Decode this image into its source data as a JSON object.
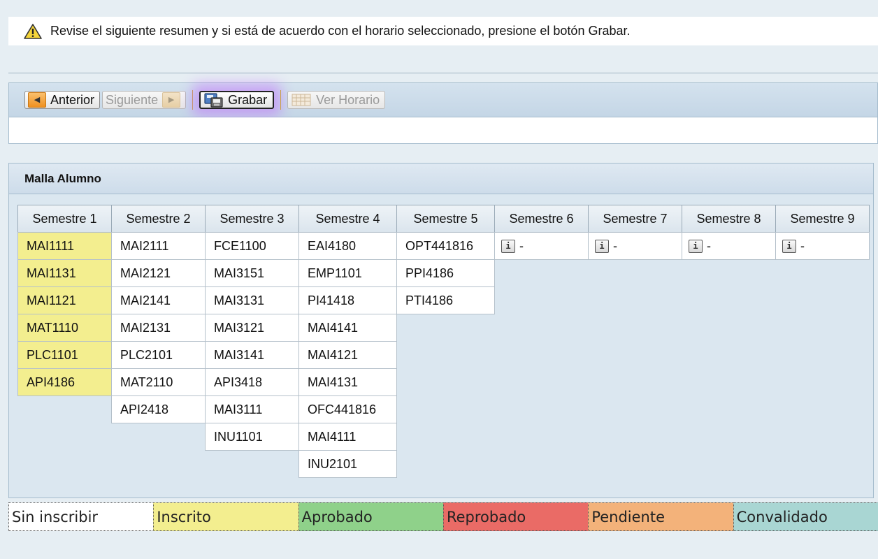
{
  "message": {
    "icon": "warning-icon",
    "text": "Revise el siguiente resumen y si está de acuerdo con el horario seleccionado, presione el botón Grabar."
  },
  "toolbar": {
    "anterior": "Anterior",
    "siguiente": "Siguiente",
    "grabar": "Grabar",
    "ver_horario": "Ver Horario"
  },
  "panel": {
    "title": "Malla Alumno",
    "columns": [
      {
        "header": "Semestre 1",
        "width": 134,
        "courses": [
          "MAI1111",
          "MAI1131",
          "MAI1121",
          "MAT1110",
          "PLC1101",
          "API4186"
        ],
        "status": "inscrito"
      },
      {
        "header": "Semestre 2",
        "width": 134,
        "courses": [
          "MAI2111",
          "MAI2121",
          "MAI2141",
          "MAI2131",
          "PLC2101",
          "MAT2110",
          "API2418"
        ],
        "status": "sin"
      },
      {
        "header": "Semestre 3",
        "width": 134,
        "courses": [
          "FCE1100",
          "MAI3151",
          "MAI3131",
          "MAI3121",
          "MAI3141",
          "API3418",
          "MAI3111",
          "INU1101"
        ],
        "status": "sin"
      },
      {
        "header": "Semestre 4",
        "width": 140,
        "courses": [
          "EAI4180",
          "EMP1101",
          "PI41418",
          "MAI4141",
          "MAI4121",
          "MAI4131",
          "OFC441816",
          "MAI4111",
          "INU2101"
        ],
        "status": "sin"
      },
      {
        "header": "Semestre 5",
        "width": 140,
        "courses": [
          "OPT441816",
          "PPI4186",
          "PTI4186"
        ],
        "status": "sin"
      },
      {
        "header": "Semestre 6",
        "width": 134,
        "courses": [
          "-"
        ],
        "status": "info"
      },
      {
        "header": "Semestre 7",
        "width": 134,
        "courses": [
          "-"
        ],
        "status": "info"
      },
      {
        "header": "Semestre 8",
        "width": 134,
        "courses": [
          "-"
        ],
        "status": "info"
      },
      {
        "header": "Semestre 9",
        "width": 134,
        "courses": [
          "-"
        ],
        "status": "info"
      }
    ]
  },
  "legend": [
    {
      "label": "Sin inscribir",
      "color": "#ffffff"
    },
    {
      "label": "Inscrito",
      "color": "#f3ee8f"
    },
    {
      "label": "Aprobado",
      "color": "#8fd18a"
    },
    {
      "label": "Reprobado",
      "color": "#ea6b66"
    },
    {
      "label": "Pendiente",
      "color": "#f3b27a"
    },
    {
      "label": "Convalidado",
      "color": "#a9d6d3"
    }
  ]
}
